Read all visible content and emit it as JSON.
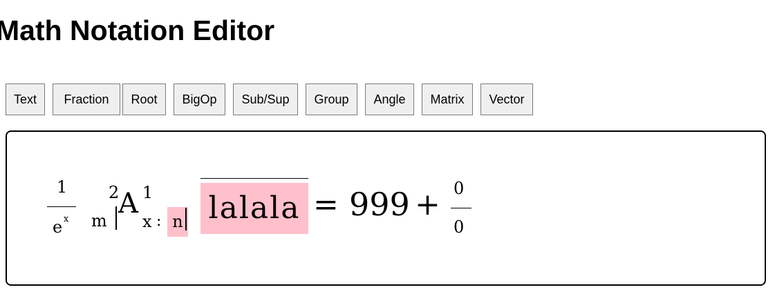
{
  "page_title": "Math Notation Editor",
  "toolbar": {
    "buttons": [
      "Text",
      "Fraction",
      "Root",
      "BigOp",
      "Sub/Sup",
      "Group",
      "Angle",
      "Matrix",
      "Vector"
    ]
  },
  "editor": {
    "fraction1": {
      "numerator": "1",
      "denominator_base": "e",
      "denominator_sup": "x"
    },
    "bigop": {
      "presub": "m",
      "presup": "2",
      "base": "A",
      "sup": "1",
      "sub": "x",
      "colon": ":",
      "sub_selected": "n"
    },
    "overline_text": "lalala",
    "equals": "=",
    "number": "999",
    "plus": "+",
    "fraction2": {
      "numerator": "0",
      "denominator": "0"
    },
    "highlight_color": "#ffc0cb"
  }
}
